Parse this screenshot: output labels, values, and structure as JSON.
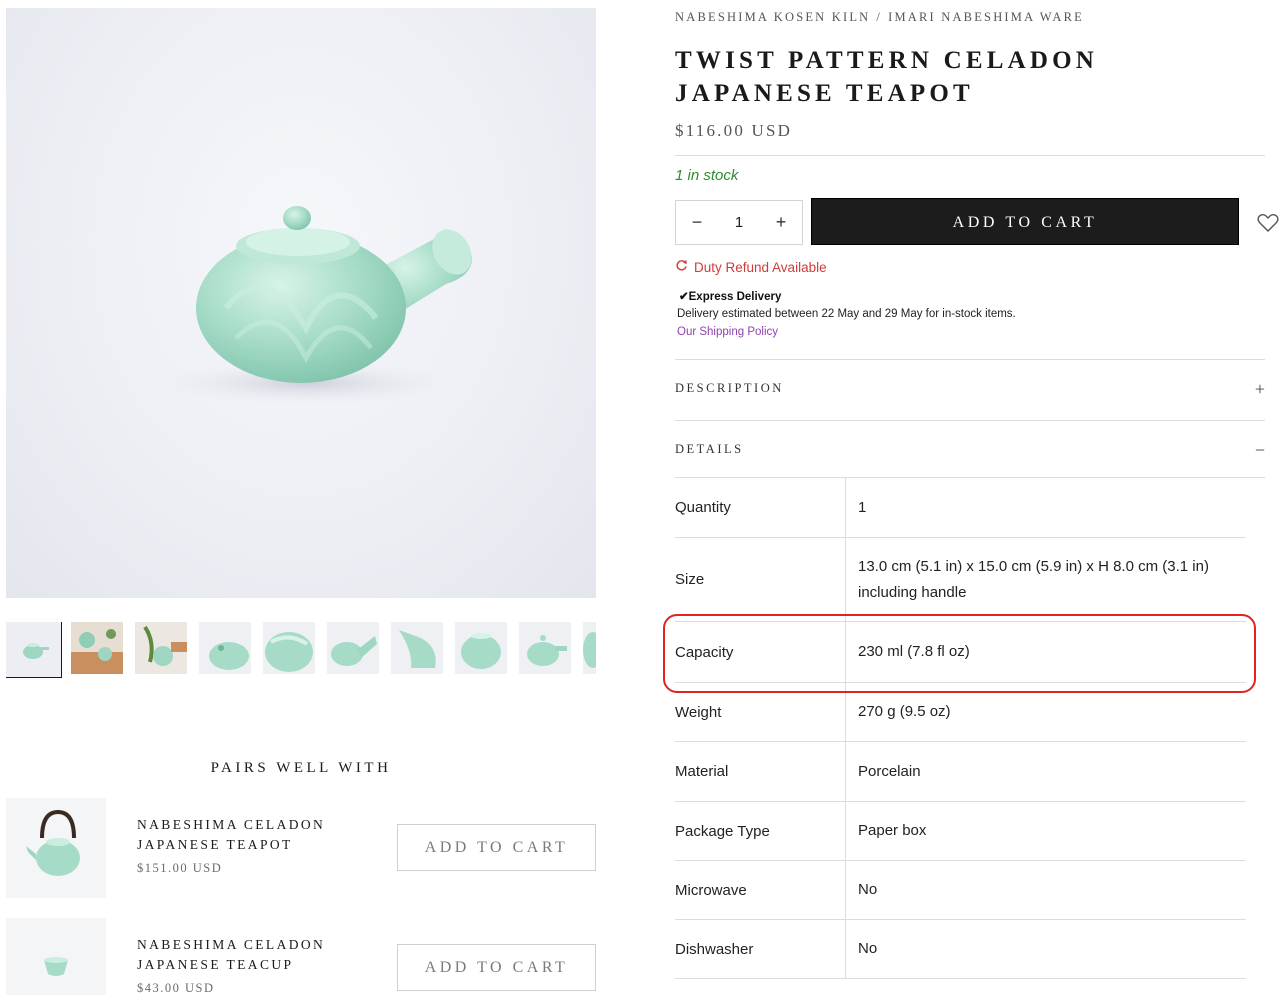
{
  "gallery": {
    "main_image_alt": "",
    "thumbnail_count": 10
  },
  "pairs": {
    "title": "PAIRS WELL WITH",
    "items": [
      {
        "name": "NABESHIMA CELADON JAPANESE TEAPOT",
        "price": "$151.00 USD",
        "button": "ADD TO CART"
      },
      {
        "name": "NABESHIMA CELADON JAPANESE TEACUP",
        "price": "$43.00 USD",
        "button": "ADD TO CART"
      }
    ]
  },
  "product": {
    "breadcrumb": [
      "NABESHIMA KOSEN KILN",
      "IMARI NABESHIMA WARE"
    ],
    "breadcrumb_sep": "/",
    "title": "TWIST PATTERN CELADON JAPANESE TEAPOT",
    "price": "$116.00 USD",
    "stock": "1 in stock",
    "quantity": "1",
    "qty_minus": "−",
    "qty_plus": "+",
    "add_to_cart": "ADD TO CART",
    "duty": "Duty Refund Available",
    "delivery_title": "✔Express Delivery",
    "delivery_text": "Delivery estimated between 22 May and 29 May for in-stock items.",
    "shipping_link": "Our Shipping Policy"
  },
  "accordions": {
    "description": {
      "label": "DESCRIPTION",
      "icon": "+"
    },
    "details": {
      "label": "DETAILS",
      "icon": "−"
    }
  },
  "details_table": [
    {
      "key": "Quantity",
      "value": "1"
    },
    {
      "key": "Size",
      "value": "13.0 cm (5.1 in) x 15.0 cm (5.9 in) x H 8.0 cm (3.1 in) including handle"
    },
    {
      "key": "Capacity",
      "value": "230 ml (7.8 fl oz)"
    },
    {
      "key": "Weight",
      "value": "270 g (9.5 oz)"
    },
    {
      "key": "Material",
      "value": "Porcelain"
    },
    {
      "key": "Package Type",
      "value": "Paper box"
    },
    {
      "key": "Microwave",
      "value": "No"
    },
    {
      "key": "Dishwasher",
      "value": "No"
    }
  ],
  "colors": {
    "accent_dark": "#1c1c1c",
    "stock_green": "#2e8b2e",
    "duty_red": "#d23a3a",
    "link_purple": "#8e44ad",
    "highlight_red": "#e02424",
    "celadon": "#a8dcc8"
  }
}
